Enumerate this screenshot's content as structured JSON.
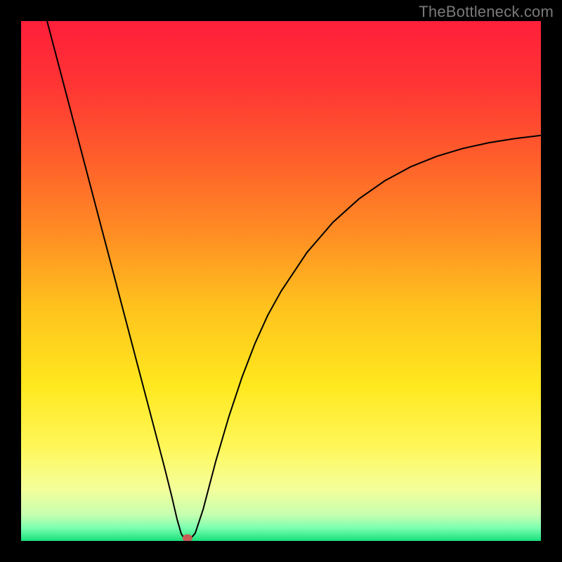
{
  "watermark": "TheBottleneck.com",
  "chart_data": {
    "type": "line",
    "title": "",
    "xlabel": "",
    "ylabel": "",
    "xlim": [
      0,
      100
    ],
    "ylim": [
      0,
      100
    ],
    "grid": false,
    "legend": false,
    "background_gradient": {
      "stops": [
        {
          "offset": 0.0,
          "color": "#ff1f3a"
        },
        {
          "offset": 0.12,
          "color": "#ff3434"
        },
        {
          "offset": 0.25,
          "color": "#ff5a2c"
        },
        {
          "offset": 0.4,
          "color": "#ff8a24"
        },
        {
          "offset": 0.55,
          "color": "#ffc21e"
        },
        {
          "offset": 0.7,
          "color": "#ffe81e"
        },
        {
          "offset": 0.82,
          "color": "#fff75a"
        },
        {
          "offset": 0.9,
          "color": "#f4ff9a"
        },
        {
          "offset": 0.95,
          "color": "#c6ffb0"
        },
        {
          "offset": 0.975,
          "color": "#7bffb0"
        },
        {
          "offset": 1.0,
          "color": "#18e07a"
        }
      ]
    },
    "annotations": [
      {
        "type": "marker",
        "x": 32,
        "y": 0,
        "color": "#c95b55",
        "shape": "ellipse"
      }
    ],
    "series": [
      {
        "name": "bottleneck-curve",
        "stroke": "#000000",
        "stroke_width": 2,
        "x": [
          5.0,
          7.5,
          10.0,
          12.5,
          15.0,
          17.5,
          20.0,
          22.5,
          25.0,
          27.5,
          29.0,
          30.0,
          30.8,
          31.5,
          32.5,
          33.5,
          35.0,
          37.5,
          40.0,
          42.5,
          45.0,
          47.5,
          50.0,
          55.0,
          60.0,
          65.0,
          70.0,
          75.0,
          80.0,
          85.0,
          90.0,
          95.0,
          100.0
        ],
        "y": [
          100.0,
          90.5,
          81.0,
          71.5,
          62.0,
          52.5,
          43.0,
          33.5,
          24.0,
          14.5,
          8.5,
          4.2,
          1.4,
          0.3,
          0.3,
          1.5,
          6.0,
          15.5,
          24.0,
          31.5,
          38.0,
          43.5,
          48.0,
          55.5,
          61.3,
          65.8,
          69.3,
          72.0,
          74.0,
          75.5,
          76.6,
          77.4,
          78.0
        ]
      }
    ]
  }
}
